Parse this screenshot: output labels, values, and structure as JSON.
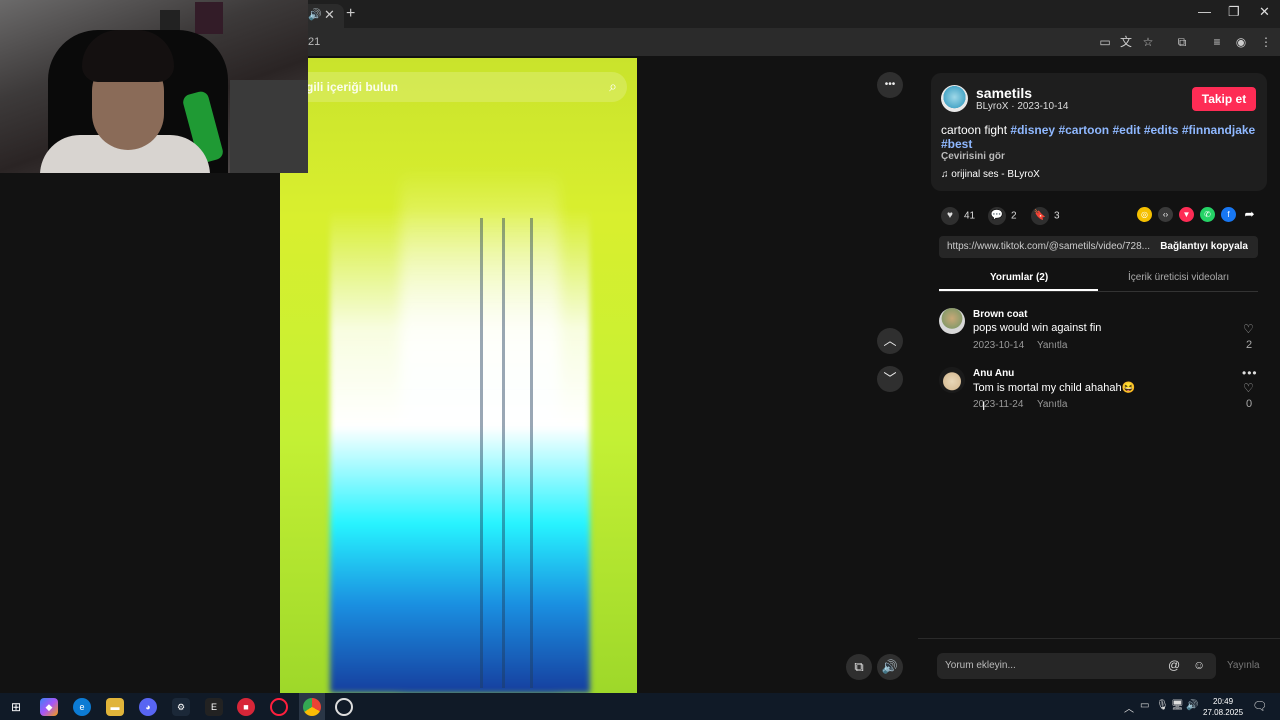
{
  "browser": {
    "address_fragment": "21",
    "tab_close": "✕",
    "new_tab": "+",
    "window_controls": [
      "—",
      "❐",
      "✕"
    ]
  },
  "video": {
    "search_placeholder": "gili içeriği bulun",
    "more_button": "•••"
  },
  "post": {
    "username": "sametils",
    "display_name": "BLyroX",
    "date": "2023-10-14",
    "follow_label": "Takip et",
    "caption_text": "cartoon fight",
    "hashtags": [
      "#disney",
      "#cartoon",
      "#edit",
      "#edits",
      "#finnandjake",
      "#best"
    ],
    "translate_label": "Çevirisini gör",
    "music": "orijinal ses - BLyroX"
  },
  "stats": {
    "likes": "41",
    "comments": "2",
    "saves": "3"
  },
  "link": {
    "url": "https://www.tiktok.com/@sametils/video/728...",
    "copy_label": "Bağlantıyı kopyala"
  },
  "tabs": {
    "comments": "Yorumlar (2)",
    "creator_videos": "İçerik üreticisi videoları"
  },
  "comments": [
    {
      "name": "Brown coat",
      "text": "pops would win against fin",
      "date": "2023-10-14",
      "reply": "Yanıtla",
      "likes": "2"
    },
    {
      "name": "Anu Anu",
      "text": "Tom is mortal my child ahahah😆",
      "date": "2023-11-24",
      "reply": "Yanıtla",
      "likes": "0"
    }
  ],
  "comment_input": {
    "placeholder": "Yorum ekleyin...",
    "post_label": "Yayınla"
  },
  "taskbar": {
    "time": "20:49",
    "date": "27.08.2025"
  },
  "colors": {
    "follow": "#fe2c55",
    "hashtag": "#8fb8ff",
    "taskbar": "#101a27"
  }
}
